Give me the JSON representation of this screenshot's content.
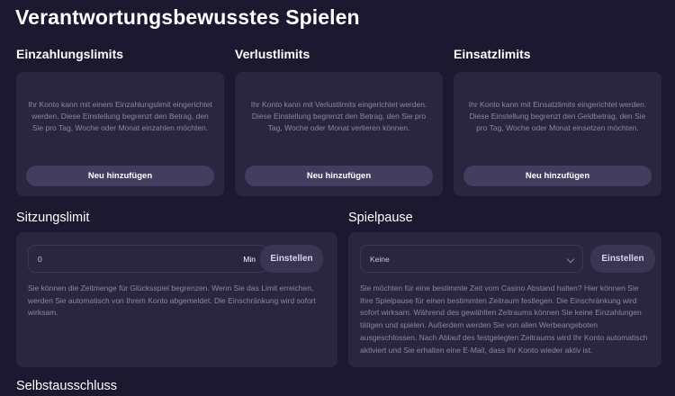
{
  "page": {
    "title": "Verantwortungsbewusstes Spielen"
  },
  "limits": [
    {
      "title": "Einzahlungslimits",
      "description": "Ihr Konto kann mit einem Einzahlungslimit eingerichtet werden. Diese Einstellung begrenzt den Betrag, den Sie pro Tag, Woche oder Monat einzahlen möchten.",
      "button": "Neu hinzufügen"
    },
    {
      "title": "Verlustlimits",
      "description": "Ihr Konto kann mit Verlustlimits eingerichtet werden. Diese Einstellung begrenzt den Betrag, den Sie pro Tag, Woche oder Monat verlieren können.",
      "button": "Neu hinzufügen"
    },
    {
      "title": "Einsatzlimits",
      "description": "Ihr Konto kann mit Einsatzlimits eingerichtet werden. Diese Einstellung begrenzt den Geldbetrag, den Sie pro Tag, Woche oder Monat einsetzen möchten.",
      "button": "Neu hinzufügen"
    }
  ],
  "session": {
    "title": "Sitzungslimit",
    "value": "0",
    "unit": "Min",
    "button": "Einstellen",
    "description": "Sie können die Zeitmenge für Glücksspiel begrenzen. Wenn Sie das Limit erreichen, werden Sie automatisch von Ihrem Konto abgemeldet. Die Einschränkung wird sofort wirksam."
  },
  "pause": {
    "title": "Spielpause",
    "selected": "Keine",
    "button": "Einstellen",
    "description": "Sie möchten für eine bestimmte Zeit vom Casino Abstand halten? Hier können Sie Ihre Spielpause für einen bestimmten Zeitraum festlegen. Die Einschränkung wird sofort wirksam. Während des gewählten Zeitraums können Sie keine Einzahlungen tätigen und spielen. Außerdem werden Sie von allen Werbeangeboten ausgeschlossen. Nach Ablauf des festgelegten Zeitraums wird Ihr Konto automatisch aktiviert und Sie erhalten eine E-Mail, dass Ihr Konto wieder aktiv ist."
  },
  "self_exclusion": {
    "title": "Selbstausschluss"
  }
}
